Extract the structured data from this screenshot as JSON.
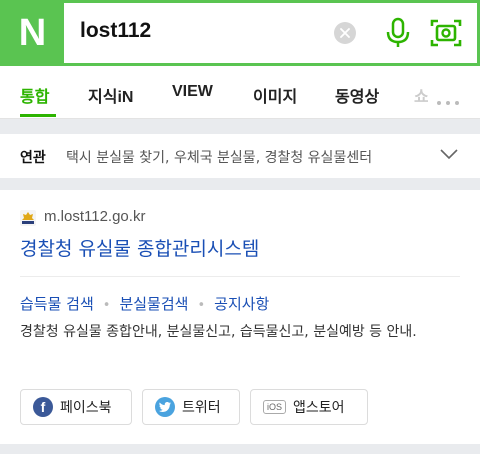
{
  "header": {
    "logo_letter": "N",
    "query": "lost112",
    "icons": [
      "clear-icon",
      "microphone-icon",
      "lens-icon"
    ]
  },
  "tabs": [
    {
      "label": "통합",
      "active": true
    },
    {
      "label": "지식iN",
      "active": false
    },
    {
      "label": "VIEW",
      "active": false
    },
    {
      "label": "이미지",
      "active": false
    },
    {
      "label": "동영상",
      "active": false
    },
    {
      "label": "쇼",
      "active": false
    }
  ],
  "related": {
    "label": "연관",
    "terms": "택시 분실물 찾기, 우체국 분실물, 경찰청 유실물센터"
  },
  "result": {
    "site_url": "m.lost112.go.kr",
    "title": "경찰청 유실물 종합관리시스템",
    "sublinks": [
      "습득물 검색",
      "분실물검색",
      "공지사항"
    ],
    "description": "경찰청 유실물 종합안내, 분실물신고, 습득물신고, 분실예방 등 안내.",
    "share": {
      "facebook": "페이스북",
      "twitter": "트위터",
      "ios_badge": "iOS",
      "appstore": "앱스토어"
    }
  },
  "colors": {
    "brand_green": "#5ac451",
    "active_tab": "#2db400",
    "link_blue": "#1a4fb5"
  }
}
